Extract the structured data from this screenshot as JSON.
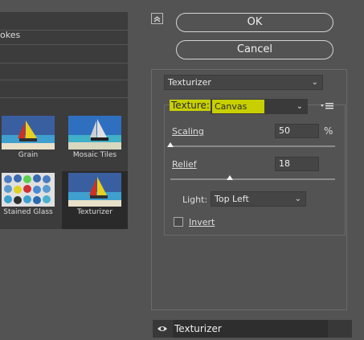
{
  "left_panel": {
    "category_label": "okes",
    "thumbnails": [
      {
        "label": "Grain"
      },
      {
        "label": "Mosaic Tiles"
      },
      {
        "label": "Stained Glass"
      },
      {
        "label": "Texturizer"
      }
    ]
  },
  "buttons": {
    "ok": "OK",
    "cancel": "Cancel"
  },
  "filter_select": {
    "value": "Texturizer"
  },
  "texture": {
    "label": "Texture:",
    "value": "Canvas"
  },
  "scaling": {
    "label": "Scaling",
    "value": "50",
    "unit": "%",
    "level": 0.0
  },
  "relief": {
    "label": "Relief",
    "value": "18",
    "level": 0.36
  },
  "light": {
    "label": "Light:",
    "value": "Top Left"
  },
  "invert": {
    "label": "Invert",
    "checked": false
  },
  "effect_layer": {
    "name": "Texturizer"
  },
  "colors": {
    "highlight": "#c8cf00",
    "panel_bg": "#535353"
  }
}
